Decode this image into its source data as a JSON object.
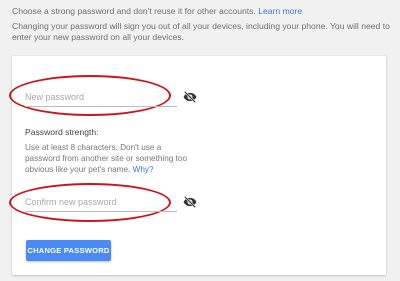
{
  "intro": {
    "line1": "Choose a strong password and don't reuse it for other accounts.",
    "learn_more": "Learn more",
    "line2": "Changing your password will sign you out of all your devices, including your phone. You will need to enter your new password on all your devices."
  },
  "form": {
    "new_password_placeholder": "New password",
    "confirm_password_placeholder": "Confirm new password",
    "strength_label": "Password strength:",
    "strength_help": "Use at least 8 characters. Don't use a password from another site or something too obvious like your pet's name.",
    "why_link": "Why?",
    "submit_label": "CHANGE PASSWORD",
    "visibility_icon": "eye-off-icon"
  },
  "colors": {
    "accent": "#4a8af4",
    "link": "#3c74d8",
    "highlight": "#d0131b"
  }
}
